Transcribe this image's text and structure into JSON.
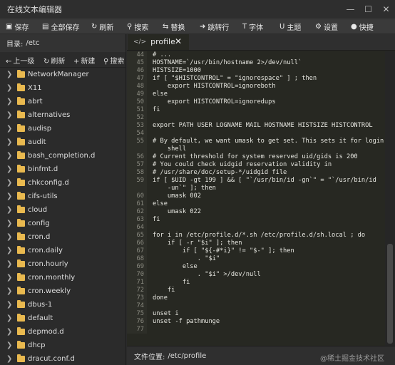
{
  "window": {
    "title": "在线文本编辑器"
  },
  "toolbar": {
    "save": "保存",
    "save_all": "全部保存",
    "refresh": "刷新",
    "search": "搜索",
    "replace": "替换",
    "goto_line": "跳转行",
    "font": "字体",
    "theme": "主题",
    "settings": "设置",
    "shortcuts": "快捷"
  },
  "sidebar": {
    "dir_label": "目录:",
    "dir_path": "/etc",
    "tools": {
      "up": "上一级",
      "refresh": "刷新",
      "new": "新建",
      "search": "搜索"
    },
    "items": [
      "NetworkManager",
      "X11",
      "abrt",
      "alternatives",
      "audisp",
      "audit",
      "bash_completion.d",
      "binfmt.d",
      "chkconfig.d",
      "cifs-utils",
      "cloud",
      "config",
      "cron.d",
      "cron.daily",
      "cron.hourly",
      "cron.monthly",
      "cron.weekly",
      "dbus-1",
      "default",
      "depmod.d",
      "dhcp",
      "dracut.conf.d"
    ]
  },
  "editor": {
    "tab": "profile",
    "lines": [
      {
        "n": "44",
        "t": "# ..."
      },
      {
        "n": "45",
        "t": "HOSTNAME=`/usr/bin/hostname 2>/dev/null`"
      },
      {
        "n": "46",
        "t": "HISTSIZE=1000"
      },
      {
        "n": "47",
        "t": "if [ \"$HISTCONTROL\" = \"ignorespace\" ] ; then"
      },
      {
        "n": "48",
        "t": "    export HISTCONTROL=ignoreboth"
      },
      {
        "n": "49",
        "t": "else"
      },
      {
        "n": "50",
        "t": "    export HISTCONTROL=ignoredups"
      },
      {
        "n": "51",
        "t": "fi"
      },
      {
        "n": "52",
        "t": ""
      },
      {
        "n": "53",
        "t": "export PATH USER LOGNAME MAIL HOSTNAME HISTSIZE HISTCONTROL"
      },
      {
        "n": "54",
        "t": ""
      },
      {
        "n": "55",
        "t": "# By default, we want umask to get set. This sets it for login"
      },
      {
        "n": "",
        "t": "    shell"
      },
      {
        "n": "56",
        "t": "# Current threshold for system reserved uid/gids is 200"
      },
      {
        "n": "57",
        "t": "# You could check uidgid reservation validity in"
      },
      {
        "n": "58",
        "t": "# /usr/share/doc/setup-*/uidgid file"
      },
      {
        "n": "59",
        "t": "if [ $UID -gt 199 ] && [ \"`/usr/bin/id -gn`\" = \"`/usr/bin/id"
      },
      {
        "n": "",
        "t": "    -un`\" ]; then"
      },
      {
        "n": "60",
        "t": "    umask 002"
      },
      {
        "n": "61",
        "t": "else"
      },
      {
        "n": "62",
        "t": "    umask 022"
      },
      {
        "n": "63",
        "t": "fi"
      },
      {
        "n": "64",
        "t": ""
      },
      {
        "n": "65",
        "t": "for i in /etc/profile.d/*.sh /etc/profile.d/sh.local ; do"
      },
      {
        "n": "66",
        "t": "    if [ -r \"$i\" ]; then"
      },
      {
        "n": "67",
        "t": "        if [ \"${-#*i}\" != \"$-\" ]; then"
      },
      {
        "n": "68",
        "t": "            . \"$i\""
      },
      {
        "n": "69",
        "t": "        else"
      },
      {
        "n": "70",
        "t": "            . \"$i\" >/dev/null"
      },
      {
        "n": "71",
        "t": "        fi"
      },
      {
        "n": "72",
        "t": "    fi"
      },
      {
        "n": "73",
        "t": "done"
      },
      {
        "n": "74",
        "t": ""
      },
      {
        "n": "75",
        "t": "unset i"
      },
      {
        "n": "76",
        "t": "unset -f pathmunge"
      },
      {
        "n": "77",
        "t": ""
      }
    ]
  },
  "status": {
    "label": "文件位置:",
    "path": "/etc/profile",
    "watermark": "@稀土掘金技术社区"
  },
  "colors": {
    "folder": "#e9b94f",
    "editor_bg": "#272822"
  }
}
